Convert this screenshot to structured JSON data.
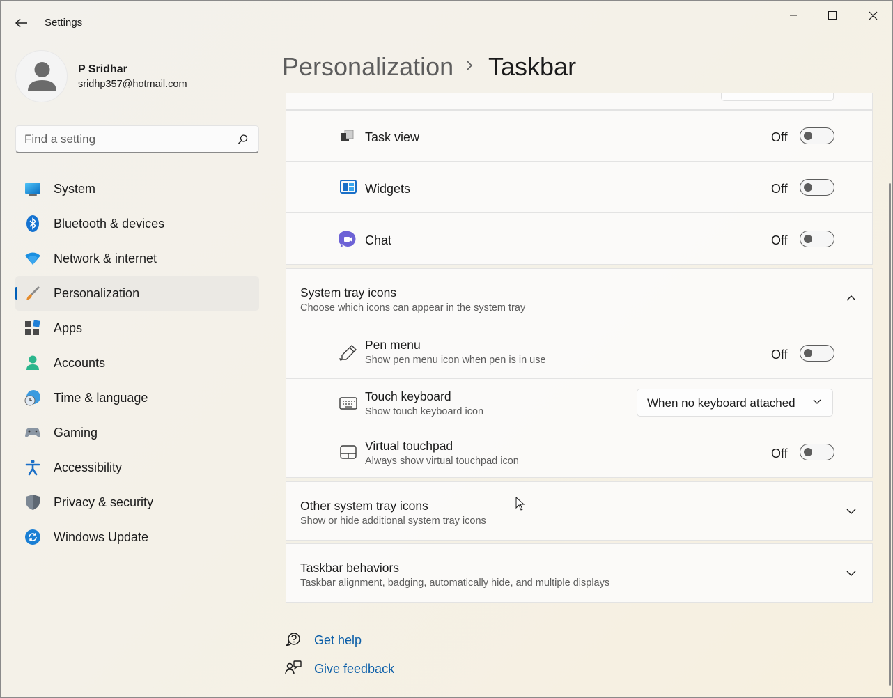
{
  "window": {
    "title": "Settings",
    "back_icon": "back-arrow-icon",
    "minimize_icon": "minimize-icon",
    "maximize_icon": "maximize-icon",
    "close_icon": "close-icon"
  },
  "profile": {
    "name": "P Sridhar",
    "email": "sridhp357@hotmail.com"
  },
  "search": {
    "placeholder": "Find a setting"
  },
  "sidebar": {
    "items": [
      {
        "label": "System",
        "icon": "system-icon"
      },
      {
        "label": "Bluetooth & devices",
        "icon": "bluetooth-icon"
      },
      {
        "label": "Network & internet",
        "icon": "wifi-icon"
      },
      {
        "label": "Personalization",
        "icon": "brush-icon",
        "active": true
      },
      {
        "label": "Apps",
        "icon": "apps-icon"
      },
      {
        "label": "Accounts",
        "icon": "accounts-icon"
      },
      {
        "label": "Time & language",
        "icon": "time-language-icon"
      },
      {
        "label": "Gaming",
        "icon": "gaming-icon"
      },
      {
        "label": "Accessibility",
        "icon": "accessibility-icon"
      },
      {
        "label": "Privacy & security",
        "icon": "shield-icon"
      },
      {
        "label": "Windows Update",
        "icon": "update-icon"
      }
    ]
  },
  "header": {
    "parent": "Personalization",
    "current": "Taskbar"
  },
  "taskbar_items": [
    {
      "label": "Task view",
      "state": "Off",
      "on": false
    },
    {
      "label": "Widgets",
      "state": "Off",
      "on": false
    },
    {
      "label": "Chat",
      "state": "Off",
      "on": false
    }
  ],
  "system_tray": {
    "title": "System tray icons",
    "subtitle": "Choose which icons can appear in the system tray",
    "expanded": true,
    "items": [
      {
        "label": "Pen menu",
        "sub": "Show pen menu icon when pen is in use",
        "state": "Off"
      },
      {
        "label": "Touch keyboard",
        "sub": "Show touch keyboard icon",
        "dropdown": "When no keyboard attached"
      },
      {
        "label": "Virtual touchpad",
        "sub": "Always show virtual touchpad icon",
        "state": "Off"
      }
    ]
  },
  "other_tray": {
    "title": "Other system tray icons",
    "subtitle": "Show or hide additional system tray icons"
  },
  "behaviors": {
    "title": "Taskbar behaviors",
    "subtitle": "Taskbar alignment, badging, automatically hide, and multiple displays"
  },
  "links": {
    "help": "Get help",
    "feedback": "Give feedback"
  },
  "colors": {
    "accent": "#005fb8",
    "link": "#0b5ea8"
  }
}
